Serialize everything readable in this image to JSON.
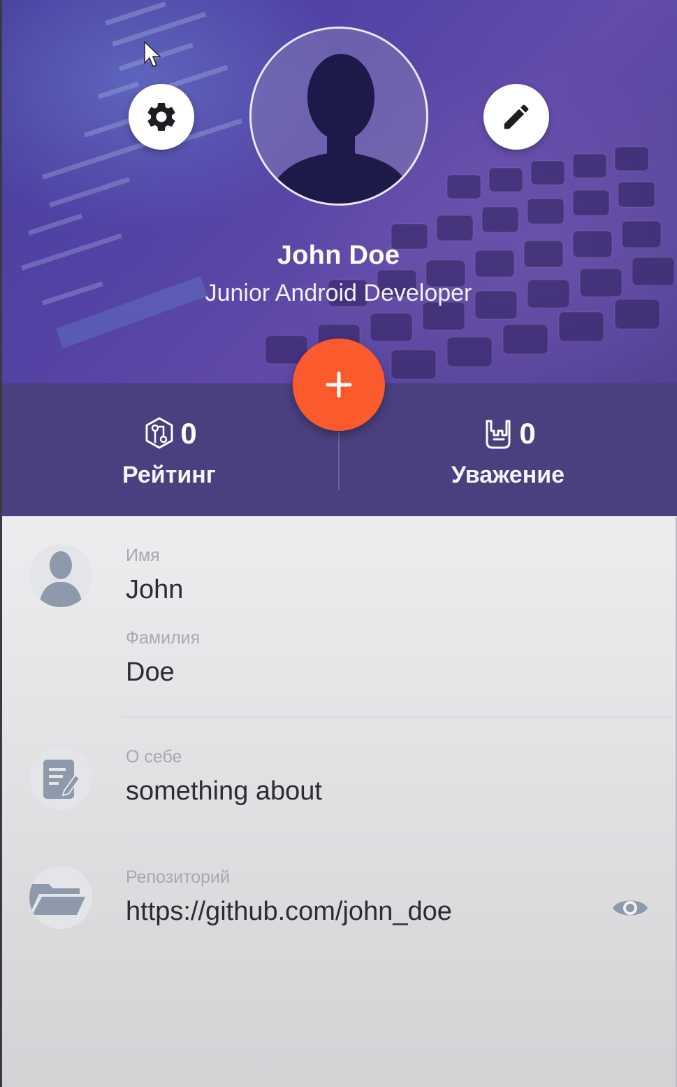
{
  "profile": {
    "name": "John Doe",
    "title": "Junior Android Developer"
  },
  "header": {
    "settings_icon": "gear-icon",
    "edit_icon": "pencil-icon",
    "avatar_icon": "person-silhouette"
  },
  "stats": {
    "rating": {
      "icon": "code-review-icon",
      "value": "0",
      "label": "Рейтинг"
    },
    "respect": {
      "icon": "rock-hand-icon",
      "value": "0",
      "label": "Уважение"
    }
  },
  "fab": {
    "icon": "plus-icon"
  },
  "fields": {
    "first_name": {
      "label": "Имя",
      "value": "John"
    },
    "last_name": {
      "label": "Фамилия",
      "value": "Doe"
    },
    "about": {
      "label": "О себе",
      "value": "something about"
    },
    "repository": {
      "label": "Репозиторий",
      "value": "https://github.com/john_doe",
      "action_icon": "eye-icon"
    }
  },
  "colors": {
    "header_purple": "#5a4ab2",
    "stats_bar": "#4a4080",
    "fab_orange": "#fb5a2c",
    "icon_gray": "#8e99ab"
  }
}
